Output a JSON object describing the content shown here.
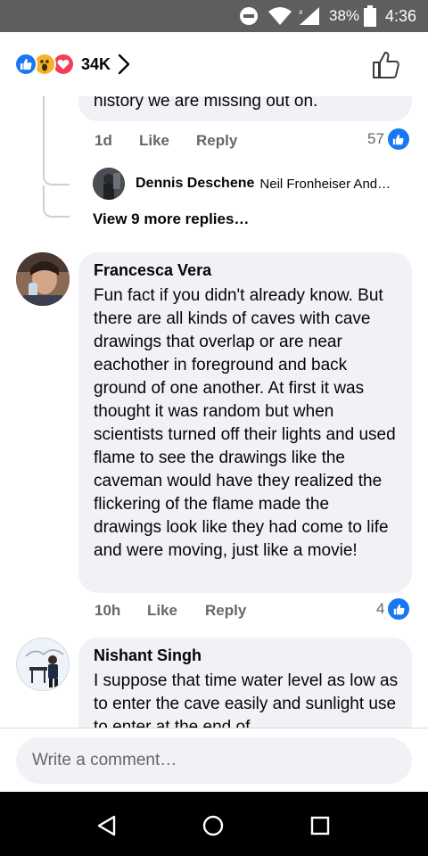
{
  "status_bar": {
    "battery": "38%",
    "time": "4:36",
    "icons": [
      "do-not-disturb-icon",
      "wifi-icon",
      "signal-icon",
      "battery-icon"
    ]
  },
  "reactions_header": {
    "count": "34K",
    "reaction_icons": [
      "like",
      "wow",
      "love"
    ]
  },
  "previous_comment": {
    "text_tail": "history we are missing out on.",
    "time": "1d",
    "like_label": "Like",
    "reply_label": "Reply",
    "like_count": "57",
    "reply_preview": {
      "author": "Dennis Deschene",
      "text": "Neil Fronheiser And…"
    },
    "view_more": "View 9 more replies…"
  },
  "comments": [
    {
      "author": "Francesca Vera",
      "text": "Fun fact if you didn't already know. But there are all kinds of caves with cave drawings that overlap or are near eachother in foreground and back ground of one another. At first it was thought it was random but when scientists turned off their lights and used flame to see the drawings like the caveman would have they realized the flickering of the flame made the drawings look like they had come to life and were moving, just like a movie!",
      "time": "10h",
      "like_label": "Like",
      "reply_label": "Reply",
      "like_count": "4"
    },
    {
      "author": "Nishant Singh",
      "text": "I suppose that time water level as low as to enter the cave easily and sunlight use to enter at the end of"
    }
  ],
  "composer": {
    "placeholder": "Write a comment…"
  },
  "colors": {
    "accent": "#1877f2",
    "bubble": "#f0f2f5",
    "meta_text": "#65676b"
  }
}
